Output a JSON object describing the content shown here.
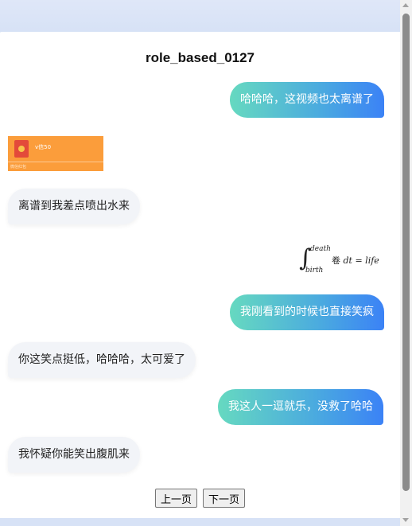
{
  "page": {
    "title": "role_based_0127"
  },
  "messages": {
    "m1": "哈哈哈，这视频也太离谱了",
    "redpacket": {
      "title": "v信50",
      "footer": "微信红包"
    },
    "m2": "离谱到我差点喷出水来",
    "formula": {
      "upper": "death",
      "lower": "birth",
      "integral": "∫",
      "body_mid": "卷",
      "body_var": "dt",
      "body_rest": "= life"
    },
    "m3": "我刚看到的时候也直接笑疯",
    "m4": "你这笑点挺低，哈哈哈，太可爱了",
    "m5": "我这人一逗就乐，没救了哈哈",
    "m6": "我怀疑你能笑出腹肌来"
  },
  "pager": {
    "prev": "上一页",
    "next": "下一页"
  },
  "colors": {
    "gradient_start": "#66d9c0",
    "gradient_end": "#3b82f6",
    "redpacket": "#fb9d3b"
  }
}
